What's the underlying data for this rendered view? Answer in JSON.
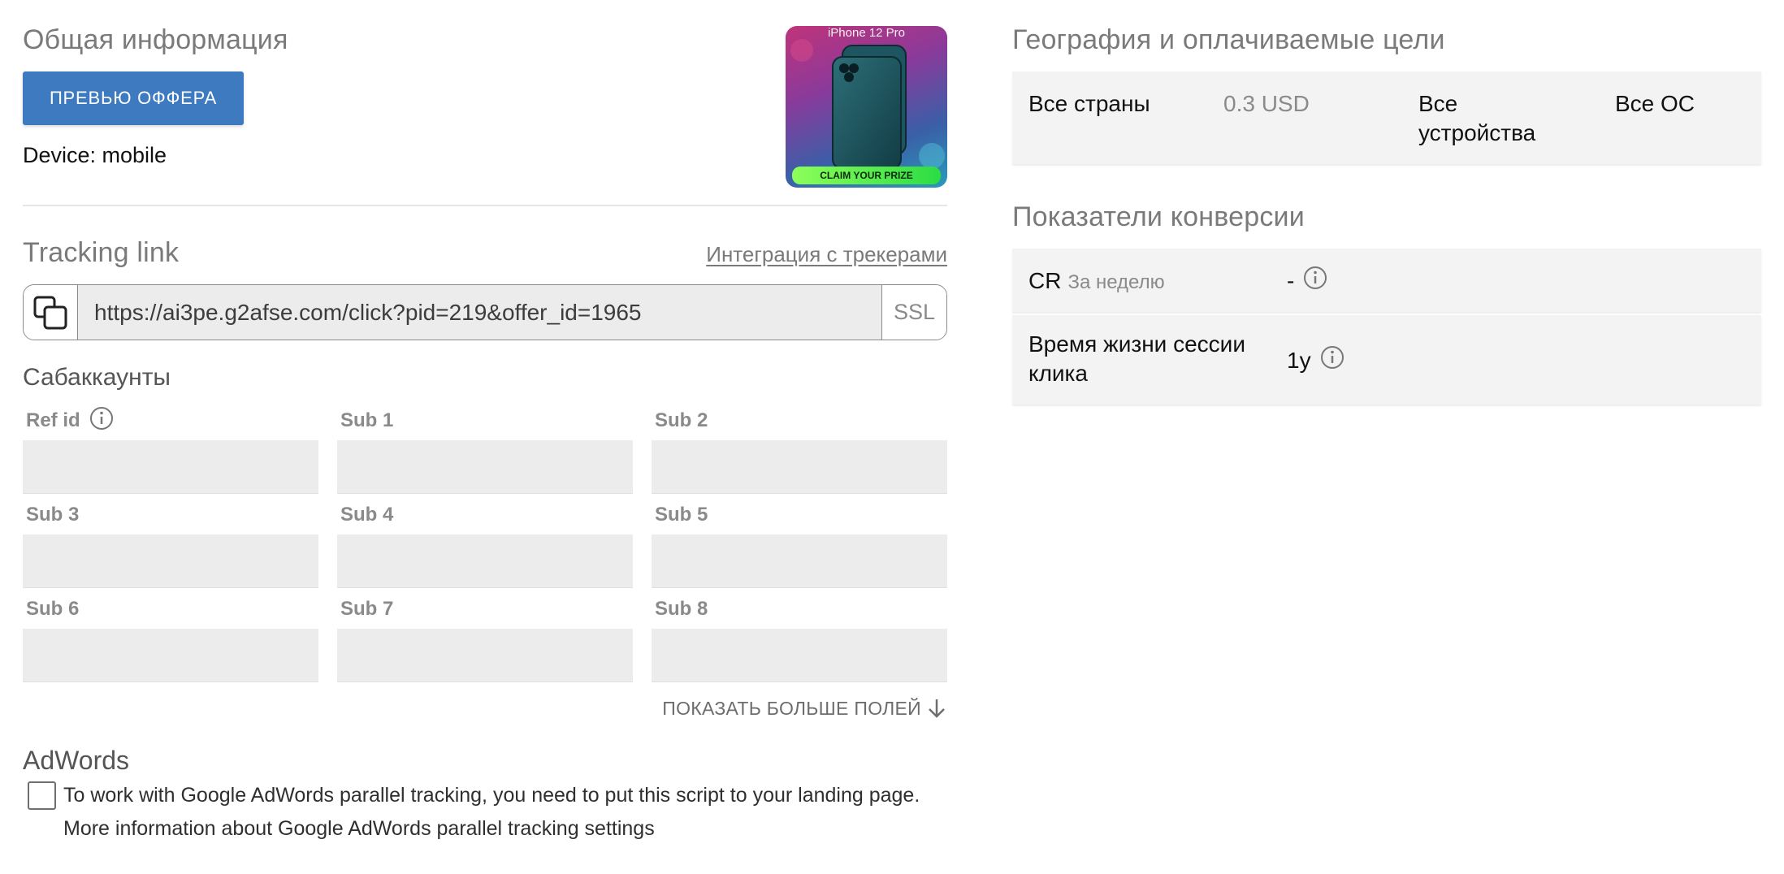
{
  "general": {
    "title": "Общая информация",
    "preview_button": "ПРЕВЬЮ ОФФЕРА",
    "device": "Device: mobile",
    "offer_image": {
      "caption": "iPhone 12 Pro",
      "cta": "CLAIM YOUR PRIZE"
    }
  },
  "tracking": {
    "title": "Tracking link",
    "integration_link": "Интеграция с трекерами",
    "url": "https://ai3pe.g2afse.com/click?pid=219&offer_id=1965",
    "ssl": "SSL"
  },
  "subaccounts": {
    "title": "Сабаккаунты",
    "fields": [
      {
        "label": "Ref id",
        "value": ""
      },
      {
        "label": "Sub 1",
        "value": ""
      },
      {
        "label": "Sub 2",
        "value": ""
      },
      {
        "label": "Sub 3",
        "value": ""
      },
      {
        "label": "Sub 4",
        "value": ""
      },
      {
        "label": "Sub 5",
        "value": ""
      },
      {
        "label": "Sub 6",
        "value": ""
      },
      {
        "label": "Sub 7",
        "value": ""
      },
      {
        "label": "Sub 8",
        "value": ""
      }
    ],
    "show_more": "ПОКАЗАТЬ БОЛЬШЕ ПОЛЕЙ"
  },
  "adwords": {
    "title": "AdWords",
    "checked": false,
    "text": "To work with Google AdWords parallel tracking, you need to put this script to your landing page.",
    "more_info": "More information about Google AdWords parallel tracking settings"
  },
  "geo": {
    "title": "География и оплачиваемые цели",
    "row": {
      "country": "Все страны",
      "price": "0.3 USD",
      "devices": "Все устройства",
      "os": "Все ОС"
    }
  },
  "conversion": {
    "title": "Показатели конверсии",
    "cr_label": "CR",
    "cr_period": "За неделю",
    "cr_value": "-",
    "session_label": "Время жизни сессии клика",
    "session_value": "1y"
  },
  "colors": {
    "accent": "#3e7ac0",
    "input_bg": "#ececec",
    "card_bg": "#f3f3f3"
  }
}
